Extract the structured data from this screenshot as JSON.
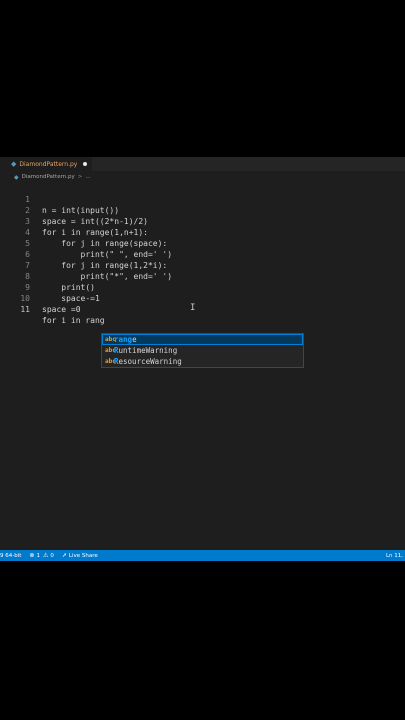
{
  "tab": {
    "title": "DiamondPattern.py",
    "icon": "python-file-icon"
  },
  "breadcrumb": {
    "file": "DiamondPattern.py",
    "separator": ">",
    "rest": "..."
  },
  "code": {
    "lines": [
      {
        "n": "1",
        "text": "n = int(input())"
      },
      {
        "n": "2",
        "text": "space = int((2*n-1)/2)"
      },
      {
        "n": "3",
        "text": "for i in range(1,n+1):"
      },
      {
        "n": "4",
        "text": "    for j in range(space):"
      },
      {
        "n": "5",
        "text": "        print(\" \", end=' ')"
      },
      {
        "n": "6",
        "text": "    for j in range(1,2*i):"
      },
      {
        "n": "7",
        "text": "        print(\"*\", end=' ')"
      },
      {
        "n": "8",
        "text": "    print()"
      },
      {
        "n": "9",
        "text": "    space-=1"
      },
      {
        "n": "10",
        "text": "space =0"
      },
      {
        "n": "11",
        "text": "for i in rang"
      }
    ]
  },
  "suggest": {
    "items": [
      {
        "match": "rang",
        "rest": "e"
      },
      {
        "match": "R",
        "rest": "untimeWarning"
      },
      {
        "match": "R",
        "rest": "esourceWarning"
      }
    ],
    "icon": "abc"
  },
  "cursor_glyph": "I",
  "status": {
    "interpreter": "9 64-bit",
    "errors": "1",
    "warnings": "0",
    "live_share": "Live Share",
    "position": "Ln 11,"
  },
  "colors": {
    "statusbar": "#007acc",
    "editor_bg": "#1e1e1e",
    "accent_match": "#18a3ff"
  }
}
